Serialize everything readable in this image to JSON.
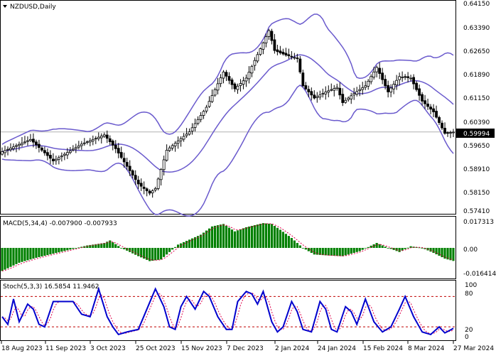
{
  "symbol_title": "NZDUSD,Daily",
  "colors": {
    "background": "#ffffff",
    "axis": "#000000",
    "bollinger": "#6a5acd",
    "candle": "#000000",
    "current_price_line": "#b0b0b0",
    "macd_hist": "#008000",
    "macd_signal": "#e0004c",
    "stoch_main": "#0000cd",
    "stoch_signal": "#e0004c",
    "level_line": "#c00000"
  },
  "price_panel": {
    "ylim": [
      0.5735,
      0.6425
    ],
    "tick_labels": [
      "0.64150",
      "0.63390",
      "0.62650",
      "0.61890",
      "0.61150",
      "0.60390",
      "0.59650",
      "0.58910",
      "0.58150",
      "0.57410"
    ],
    "current_price": "0.59994",
    "current_price_value": 0.59994
  },
  "macd_panel": {
    "title": "MACD(5,34,4) -0.007900 -0.007933",
    "ylim": [
      -0.0185,
      0.0185
    ],
    "tick_labels": [
      "0.017313",
      "0.00",
      "-0.016414"
    ]
  },
  "stoch_panel": {
    "title": "Stoch(5,3,3) 16.5854 11.9462",
    "ylim": [
      -5,
      110
    ],
    "tick_labels": [
      "100",
      "80",
      "20",
      "0"
    ],
    "levels": [
      80,
      20
    ]
  },
  "time_axis": {
    "labels": [
      "18 Aug 2023",
      "11 Sep 2023",
      "3 Oct 2023",
      "25 Oct 2023",
      "15 Nov 2023",
      "7 Dec 2023",
      "2 Jan 2024",
      "24 Jan 2024",
      "15 Feb 2024",
      "8 Mar 2024",
      "27 Mar 2024"
    ]
  },
  "chart_data": {
    "type": "candlestick",
    "title": "NZDUSD,Daily",
    "bars": 160,
    "close_keypoints": [
      [
        0,
        0.5935
      ],
      [
        10,
        0.5975
      ],
      [
        18,
        0.5905
      ],
      [
        28,
        0.596
      ],
      [
        36,
        0.599
      ],
      [
        40,
        0.5945
      ],
      [
        48,
        0.583
      ],
      [
        52,
        0.58
      ],
      [
        54,
        0.5815
      ],
      [
        58,
        0.594
      ],
      [
        66,
        0.6
      ],
      [
        72,
        0.608
      ],
      [
        78,
        0.6195
      ],
      [
        82,
        0.614
      ],
      [
        86,
        0.6175
      ],
      [
        92,
        0.629
      ],
      [
        94,
        0.633
      ],
      [
        96,
        0.6265
      ],
      [
        100,
        0.625
      ],
      [
        104,
        0.624
      ],
      [
        106,
        0.615
      ],
      [
        110,
        0.611
      ],
      [
        114,
        0.613
      ],
      [
        118,
        0.6145
      ],
      [
        120,
        0.6095
      ],
      [
        124,
        0.6125
      ],
      [
        128,
        0.615
      ],
      [
        132,
        0.621
      ],
      [
        136,
        0.613
      ],
      [
        140,
        0.618
      ],
      [
        144,
        0.6175
      ],
      [
        148,
        0.61
      ],
      [
        152,
        0.6065
      ],
      [
        156,
        0.5995
      ],
      [
        159,
        0.5999
      ]
    ],
    "macd_keypoints": [
      [
        0,
        -0.014
      ],
      [
        6,
        -0.009
      ],
      [
        12,
        -0.006
      ],
      [
        18,
        -0.0035
      ],
      [
        24,
        -0.001
      ],
      [
        30,
        0.0015
      ],
      [
        36,
        0.003
      ],
      [
        38,
        0.0045
      ],
      [
        42,
        0.0
      ],
      [
        48,
        -0.005
      ],
      [
        52,
        -0.008
      ],
      [
        56,
        -0.007
      ],
      [
        62,
        0.002
      ],
      [
        70,
        0.008
      ],
      [
        74,
        0.013
      ],
      [
        78,
        0.0145
      ],
      [
        82,
        0.01
      ],
      [
        86,
        0.0125
      ],
      [
        92,
        0.015
      ],
      [
        95,
        0.0145
      ],
      [
        98,
        0.011
      ],
      [
        102,
        0.006
      ],
      [
        106,
        0.0
      ],
      [
        110,
        -0.004
      ],
      [
        114,
        -0.0045
      ],
      [
        120,
        -0.005
      ],
      [
        126,
        -0.002
      ],
      [
        132,
        0.003
      ],
      [
        136,
        0.0
      ],
      [
        140,
        -0.0025
      ],
      [
        144,
        0.001
      ],
      [
        148,
        0.0
      ],
      [
        152,
        -0.003
      ],
      [
        156,
        -0.0065
      ],
      [
        159,
        -0.0079
      ]
    ],
    "stoch_keypoints": [
      [
        0,
        40
      ],
      [
        2,
        25
      ],
      [
        4,
        75
      ],
      [
        6,
        30
      ],
      [
        9,
        65
      ],
      [
        11,
        55
      ],
      [
        13,
        25
      ],
      [
        15,
        20
      ],
      [
        18,
        70
      ],
      [
        22,
        70
      ],
      [
        25,
        70
      ],
      [
        28,
        45
      ],
      [
        31,
        40
      ],
      [
        34,
        95
      ],
      [
        37,
        40
      ],
      [
        39,
        20
      ],
      [
        41,
        5
      ],
      [
        44,
        10
      ],
      [
        48,
        15
      ],
      [
        51,
        55
      ],
      [
        54,
        95
      ],
      [
        57,
        60
      ],
      [
        59,
        20
      ],
      [
        61,
        15
      ],
      [
        63,
        60
      ],
      [
        65,
        80
      ],
      [
        68,
        55
      ],
      [
        71,
        90
      ],
      [
        73,
        80
      ],
      [
        76,
        40
      ],
      [
        79,
        15
      ],
      [
        81,
        15
      ],
      [
        83,
        70
      ],
      [
        86,
        90
      ],
      [
        88,
        85
      ],
      [
        90,
        65
      ],
      [
        92,
        90
      ],
      [
        95,
        30
      ],
      [
        97,
        10
      ],
      [
        99,
        20
      ],
      [
        102,
        70
      ],
      [
        104,
        50
      ],
      [
        106,
        15
      ],
      [
        109,
        10
      ],
      [
        112,
        70
      ],
      [
        114,
        55
      ],
      [
        116,
        15
      ],
      [
        118,
        10
      ],
      [
        121,
        60
      ],
      [
        123,
        50
      ],
      [
        125,
        25
      ],
      [
        128,
        75
      ],
      [
        131,
        30
      ],
      [
        134,
        10
      ],
      [
        137,
        20
      ],
      [
        140,
        55
      ],
      [
        142,
        80
      ],
      [
        145,
        40
      ],
      [
        148,
        10
      ],
      [
        151,
        5
      ],
      [
        154,
        20
      ],
      [
        156,
        8
      ],
      [
        159,
        17
      ]
    ]
  }
}
